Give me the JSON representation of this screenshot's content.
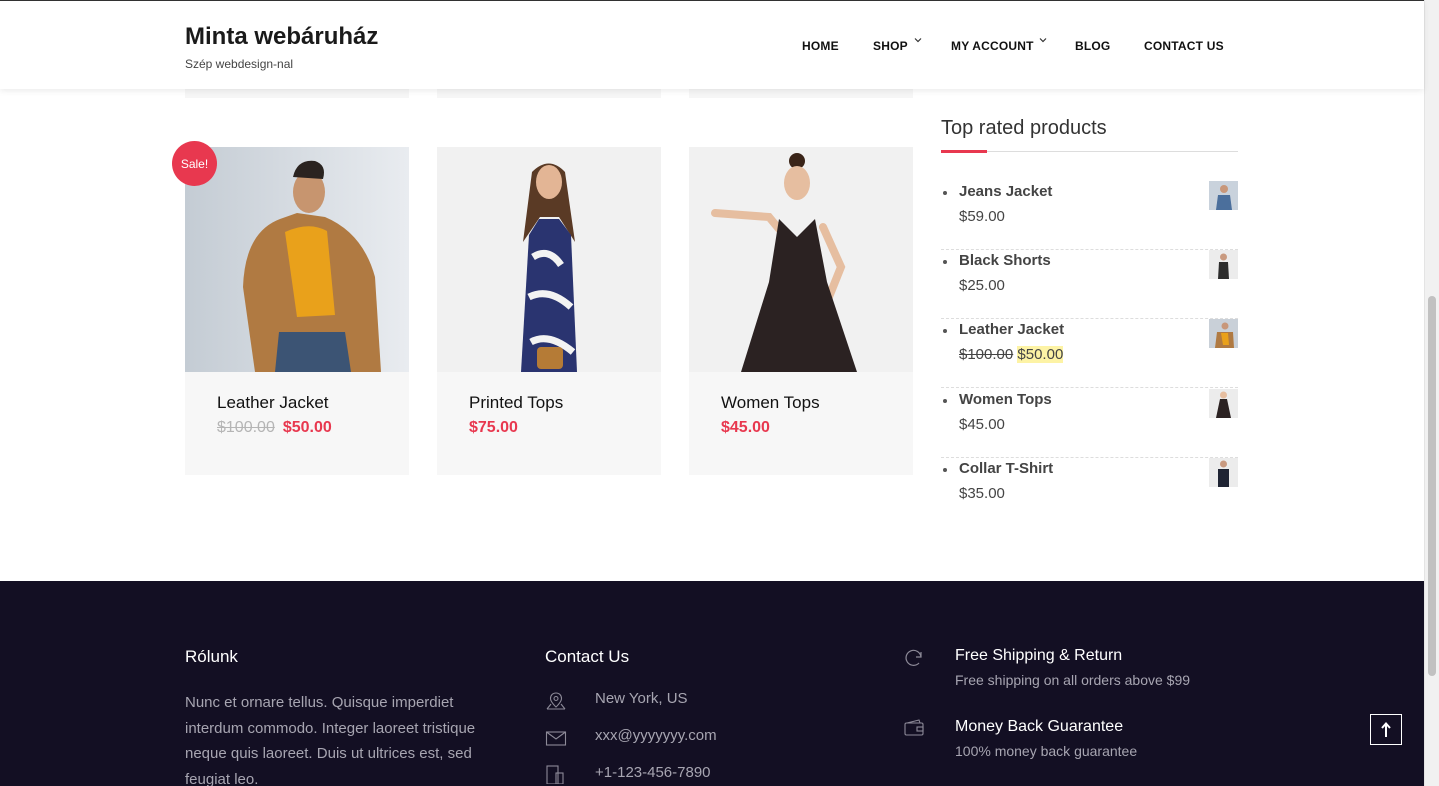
{
  "header": {
    "title": "Minta webáruház",
    "tagline": "Szép webdesign-nal",
    "nav": [
      "HOME",
      "SHOP",
      "MY ACCOUNT",
      "BLOG",
      "CONTACT US"
    ]
  },
  "products": [
    {
      "name": "Leather Jacket",
      "old_price": "$100.00",
      "price": "$50.00",
      "badge": "Sale!"
    },
    {
      "name": "Printed Tops",
      "price": "$75.00"
    },
    {
      "name": "Women Tops",
      "price": "$45.00"
    }
  ],
  "sidebar": {
    "title": "Top rated products",
    "items": [
      {
        "name": "Jeans Jacket",
        "price": "$59.00"
      },
      {
        "name": "Black Shorts",
        "price": "$25.00"
      },
      {
        "name": "Leather Jacket",
        "old_price": "$100.00",
        "price": "$50.00"
      },
      {
        "name": "Women Tops",
        "price": "$45.00"
      },
      {
        "name": "Collar T-Shirt",
        "price": "$35.00"
      }
    ]
  },
  "footer": {
    "about_title": "Rólunk",
    "about_text": "Nunc et ornare tellus. Quisque imperdiet interdum commodo. Integer laoreet tristique neque quis laoreet. Duis ut ultrices est, sed feugiat leo.",
    "contact_title": "Contact Us",
    "address": "New York, US",
    "email": "xxx@yyyyyyy.com",
    "phone": "+1-123-456-7890",
    "features": [
      {
        "title": "Free Shipping & Return",
        "text": "Free shipping on all orders above $99",
        "icon": "refresh-icon"
      },
      {
        "title": "Money Back Guarantee",
        "text": "100% money back guarantee",
        "icon": "wallet-icon"
      }
    ]
  },
  "colors": {
    "accent": "#e8384f",
    "footer_bg": "#130f23",
    "highlight": "#fdf3a5"
  }
}
